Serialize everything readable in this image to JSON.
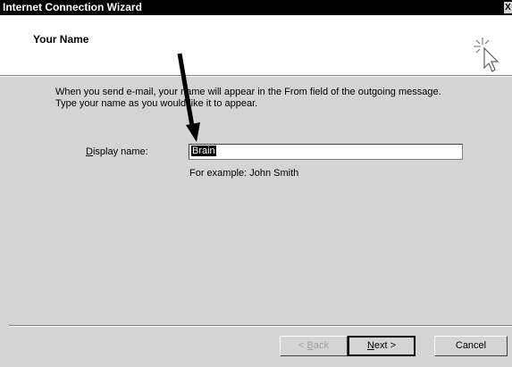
{
  "window": {
    "title": "Internet Connection Wizard",
    "close_glyph": "X"
  },
  "header": {
    "title": "Your Name",
    "icon": "wizard-pointer-icon"
  },
  "intro": {
    "line1": "When you send e-mail, your name will appear in the From field of the outgoing message.",
    "line2": "Type your name as you would like it to appear."
  },
  "form": {
    "display_name_label_prefix": "D",
    "display_name_label_rest": "isplay name:",
    "display_name_value": "Brain",
    "example_text": "For example: John Smith"
  },
  "buttons": {
    "back_prefix": "< ",
    "back_hotkey": "B",
    "back_rest": "ack",
    "next_hotkey": "N",
    "next_rest": "ext >",
    "cancel": "Cancel"
  },
  "annotation": {
    "arrow_icon": "annotation-arrow-icon"
  }
}
